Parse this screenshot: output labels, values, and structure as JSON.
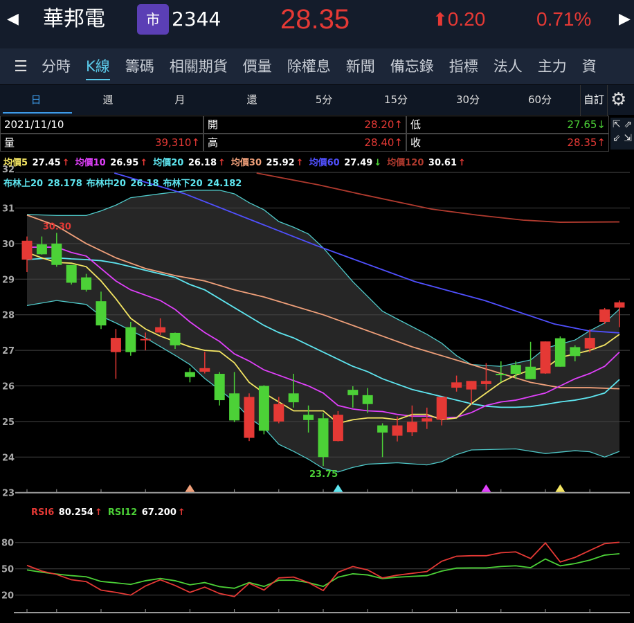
{
  "header": {
    "prev_icon": "◀",
    "next_icon": "▶",
    "name": "華邦電",
    "market_badge": "市",
    "code": "2344",
    "price": "28.35",
    "change": "0.20",
    "change_arrow": "🡅",
    "pct": "0.71%"
  },
  "tabs": [
    "分時",
    "K線",
    "籌碼",
    "相關期貨",
    "價量",
    "除權息",
    "新聞",
    "備忘錄",
    "指標",
    "法人",
    "主力",
    "資"
  ],
  "active_tab": 1,
  "subtabs": [
    "日",
    "週",
    "月",
    "還",
    "5分",
    "15分",
    "30分",
    "60分"
  ],
  "custom_label": "自訂",
  "info": {
    "date": "2021/11/10",
    "open_label": "開",
    "open": "28.20↑",
    "low_label": "低",
    "low": "27.65↓",
    "volume_label": "量",
    "volume": "39,310↑",
    "high_label": "高",
    "high": "28.40↑",
    "close_label": "收",
    "close": "28.35↑"
  },
  "ma_legend": [
    {
      "label": "均價5",
      "value": "27.45",
      "arrow": "↑",
      "color": "#f5e663"
    },
    {
      "label": "均價10",
      "value": "26.95",
      "arrow": "↑",
      "color": "#e040fb"
    },
    {
      "label": "均價20",
      "value": "26.18",
      "arrow": "↑",
      "color": "#5ee6f0"
    },
    {
      "label": "均價30",
      "value": "25.92",
      "arrow": "↑",
      "color": "#f0a07a"
    },
    {
      "label": "均價60",
      "value": "27.49",
      "arrow": "↓",
      "color": "#5050ff"
    },
    {
      "label": "均價120",
      "value": "30.61",
      "arrow": "↑",
      "color": "#b03a2e"
    }
  ],
  "boll_legend": [
    {
      "label": "布林上20",
      "value": "28.178"
    },
    {
      "label": "布林中20",
      "value": "26.18"
    },
    {
      "label": "布林下20",
      "value": "24.182"
    }
  ],
  "rsi_legend": [
    {
      "label": "RSI6",
      "value": "80.254",
      "arrow": "↑",
      "color": "#e53935"
    },
    {
      "label": "RSI12",
      "value": "67.200",
      "arrow": "↑",
      "color": "#4cd137"
    }
  ],
  "chart_data": {
    "type": "candlestick",
    "y_ticks": [
      "32",
      "31",
      "30",
      "29",
      "28",
      "27",
      "26",
      "25",
      "24",
      "23"
    ],
    "ylim": [
      23,
      32
    ],
    "candles_ohlc": [
      [
        29.55,
        30.2,
        29.2,
        30.08
      ],
      [
        29.98,
        30.2,
        29.69,
        29.7
      ],
      [
        30.0,
        30.3,
        29.35,
        29.4
      ],
      [
        29.4,
        29.4,
        28.85,
        28.9
      ],
      [
        29.05,
        29.15,
        28.65,
        28.7
      ],
      [
        28.38,
        28.65,
        27.6,
        27.7
      ],
      [
        26.95,
        27.6,
        26.2,
        27.35
      ],
      [
        27.65,
        27.8,
        26.85,
        26.95
      ],
      [
        27.3,
        27.5,
        27.0,
        27.32
      ],
      [
        27.5,
        27.9,
        27.43,
        27.65
      ],
      [
        27.49,
        27.5,
        27.04,
        27.14
      ],
      [
        26.39,
        26.5,
        26.1,
        26.25
      ],
      [
        26.4,
        26.96,
        26.35,
        26.5
      ],
      [
        26.34,
        26.39,
        25.45,
        25.6
      ],
      [
        25.79,
        26.39,
        24.98,
        25.03
      ],
      [
        24.54,
        25.79,
        24.45,
        25.69
      ],
      [
        26.0,
        26.02,
        24.64,
        24.74
      ],
      [
        25.0,
        25.69,
        24.95,
        25.49
      ],
      [
        25.79,
        26.34,
        25.39,
        25.54
      ],
      [
        25.19,
        25.45,
        24.69,
        25.04
      ],
      [
        25.09,
        25.24,
        23.75,
        24.0
      ],
      [
        24.45,
        25.29,
        24.44,
        25.19
      ],
      [
        25.89,
        25.99,
        25.39,
        25.74
      ],
      [
        25.74,
        25.94,
        25.24,
        25.49
      ],
      [
        24.89,
        24.95,
        24.0,
        24.69
      ],
      [
        24.6,
        25.14,
        24.44,
        24.89
      ],
      [
        24.7,
        25.45,
        24.59,
        24.99
      ],
      [
        25.0,
        25.39,
        24.79,
        25.09
      ],
      [
        25.05,
        25.69,
        24.89,
        25.69
      ],
      [
        25.95,
        26.29,
        25.84,
        26.1
      ],
      [
        25.9,
        26.14,
        25.49,
        26.14
      ],
      [
        26.05,
        26.64,
        25.89,
        26.14
      ],
      [
        26.34,
        26.69,
        26.1,
        26.3
      ],
      [
        26.59,
        26.69,
        26.19,
        26.34
      ],
      [
        26.54,
        27.24,
        26.19,
        26.19
      ],
      [
        26.35,
        27.25,
        26.34,
        27.25
      ],
      [
        27.34,
        27.39,
        26.54,
        26.54
      ],
      [
        27.09,
        27.14,
        26.69,
        26.84
      ],
      [
        27.05,
        27.59,
        26.94,
        27.35
      ],
      [
        27.8,
        28.19,
        27.74,
        28.15
      ],
      [
        28.2,
        28.4,
        27.65,
        28.35
      ]
    ],
    "up_color": "#e53935",
    "down_color": "#4cd137",
    "lines": [
      {
        "name": "boll_upper",
        "color": "#4fc9c9",
        "points": [
          [
            0,
            30.82
          ],
          [
            2,
            30.79
          ],
          [
            4,
            30.79
          ],
          [
            5,
            30.92
          ],
          [
            6,
            31.08
          ],
          [
            7,
            31.29
          ],
          [
            9,
            31.4
          ],
          [
            11,
            31.5
          ],
          [
            13,
            31.5
          ],
          [
            14,
            31.4
          ],
          [
            15,
            31.15
          ],
          [
            16,
            30.95
          ],
          [
            17,
            30.62
          ],
          [
            18,
            30.46
          ],
          [
            19,
            30.27
          ],
          [
            20,
            29.88
          ],
          [
            22,
            28.93
          ],
          [
            24,
            28.1
          ],
          [
            25,
            27.88
          ],
          [
            27,
            27.45
          ],
          [
            28,
            27.2
          ],
          [
            29,
            26.85
          ],
          [
            30,
            26.6
          ],
          [
            32,
            26.55
          ],
          [
            34,
            26.73
          ],
          [
            35,
            27.06
          ],
          [
            37,
            27.29
          ],
          [
            38,
            27.55
          ],
          [
            39,
            27.77
          ],
          [
            40,
            28.16
          ]
        ]
      },
      {
        "name": "boll_lower",
        "color": "#4fc9c9",
        "points": [
          [
            0,
            28.26
          ],
          [
            2,
            28.4
          ],
          [
            4,
            28.29
          ],
          [
            5,
            27.96
          ],
          [
            6,
            27.77
          ],
          [
            8,
            27.35
          ],
          [
            10,
            26.86
          ],
          [
            11,
            26.6
          ],
          [
            12,
            26.21
          ],
          [
            13,
            25.89
          ],
          [
            14,
            25.56
          ],
          [
            15,
            25.1
          ],
          [
            16,
            24.82
          ],
          [
            17,
            24.36
          ],
          [
            18,
            24.16
          ],
          [
            19,
            23.94
          ],
          [
            20,
            23.68
          ],
          [
            21,
            23.58
          ],
          [
            22,
            23.71
          ],
          [
            23,
            23.8
          ],
          [
            25,
            23.84
          ],
          [
            27,
            23.78
          ],
          [
            28,
            23.87
          ],
          [
            29,
            24.07
          ],
          [
            30,
            24.2
          ],
          [
            33,
            24.23
          ],
          [
            35,
            24.1
          ],
          [
            37,
            24.18
          ],
          [
            38,
            24.15
          ],
          [
            39,
            24.0
          ],
          [
            40,
            24.16
          ]
        ]
      },
      {
        "name": "ma120",
        "color": "#b03a2e",
        "points": [
          [
            15.5,
            32.0
          ],
          [
            19.7,
            31.65
          ],
          [
            22.4,
            31.4
          ],
          [
            27.3,
            30.97
          ],
          [
            30.4,
            30.8
          ],
          [
            33.5,
            30.66
          ],
          [
            36,
            30.6
          ],
          [
            40,
            30.61
          ]
        ]
      },
      {
        "name": "ma60",
        "color": "#5050ff",
        "points": [
          [
            5.9,
            32.0
          ],
          [
            10.65,
            31.4
          ],
          [
            19.5,
            29.95
          ],
          [
            26.2,
            28.93
          ],
          [
            30.9,
            28.4
          ],
          [
            35.6,
            27.74
          ],
          [
            37.9,
            27.55
          ],
          [
            40,
            27.49
          ]
        ]
      },
      {
        "name": "ma30",
        "color": "#f0a07a",
        "points": [
          [
            0,
            30.8
          ],
          [
            2,
            30.5
          ],
          [
            4,
            30.0
          ],
          [
            6,
            29.6
          ],
          [
            8,
            29.3
          ],
          [
            10,
            29.1
          ],
          [
            12,
            28.95
          ],
          [
            14,
            28.7
          ],
          [
            16,
            28.5
          ],
          [
            18,
            28.25
          ],
          [
            20,
            28.0
          ],
          [
            22,
            27.7
          ],
          [
            24,
            27.4
          ],
          [
            26,
            27.1
          ],
          [
            28,
            26.85
          ],
          [
            30,
            26.6
          ],
          [
            32,
            26.35
          ],
          [
            34,
            26.1
          ],
          [
            36,
            25.95
          ],
          [
            38,
            25.95
          ],
          [
            40,
            25.92
          ]
        ]
      },
      {
        "name": "ma20",
        "color": "#5ee6f0",
        "values": [
          29.55,
          29.58,
          29.6,
          29.57,
          29.55,
          29.52,
          29.45,
          29.35,
          29.25,
          29.15,
          29.05,
          28.85,
          28.7,
          28.45,
          28.2,
          27.95,
          27.7,
          27.5,
          27.35,
          27.15,
          26.95,
          26.75,
          26.55,
          26.4,
          26.2,
          26.05,
          25.9,
          25.8,
          25.7,
          25.6,
          25.5,
          25.43,
          25.4,
          25.4,
          25.42,
          25.48,
          25.55,
          25.6,
          25.68,
          25.8,
          26.18
        ]
      },
      {
        "name": "ma10",
        "color": "#e040fb",
        "values": [
          29.9,
          29.9,
          29.9,
          29.75,
          29.65,
          29.3,
          28.95,
          28.7,
          28.55,
          28.4,
          28.15,
          27.8,
          27.5,
          27.25,
          26.9,
          26.7,
          26.45,
          26.3,
          26.15,
          26.0,
          25.8,
          25.45,
          25.35,
          25.3,
          25.28,
          25.2,
          25.15,
          25.15,
          25.1,
          25.12,
          25.25,
          25.45,
          25.55,
          25.6,
          25.7,
          25.8,
          26.0,
          26.2,
          26.35,
          26.55,
          26.95
        ]
      },
      {
        "name": "ma5",
        "color": "#f5e663",
        "values": [
          29.75,
          29.6,
          29.47,
          29.45,
          29.35,
          28.95,
          28.45,
          27.9,
          27.6,
          27.4,
          27.25,
          27.1,
          27.0,
          26.97,
          26.65,
          26.1,
          25.8,
          25.55,
          25.3,
          25.3,
          25.3,
          24.95,
          25.05,
          25.1,
          25.1,
          25.05,
          25.2,
          25.2,
          25.05,
          25.1,
          25.5,
          25.8,
          26.1,
          26.3,
          26.45,
          26.5,
          26.8,
          26.9,
          27.0,
          27.15,
          27.45
        ]
      }
    ],
    "annotations": [
      {
        "text": "30.30",
        "index": 2,
        "value": 30.3,
        "color": "#e53935"
      },
      {
        "text": "23.75",
        "index": 20,
        "value": 23.75,
        "color": "#4cd137"
      }
    ],
    "signal_markers": [
      {
        "index": 11,
        "color": "#f0a07a"
      },
      {
        "index": 21,
        "color": "#5ee6f0"
      },
      {
        "index": 31,
        "color": "#e040fb"
      },
      {
        "index": 36,
        "color": "#f5e663"
      }
    ],
    "x_tick_indices": [
      0,
      2,
      5,
      8,
      11,
      14,
      17,
      20,
      23,
      26,
      29,
      32,
      35,
      38
    ],
    "rsi": {
      "y_ticks": [
        "80",
        "50",
        "20"
      ],
      "rsi6": [
        53.9,
        47.4,
        43.5,
        37.5,
        35.4,
        25.7,
        23.1,
        20,
        30.4,
        37.5,
        31,
        23.1,
        29.1,
        21.8,
        18.4,
        33.5,
        25.7,
        39.6,
        40.6,
        34.3,
        25.2,
        46.1,
        52.6,
        48.7,
        39.6,
        42.7,
        44.8,
        46.9,
        58.6,
        64.3,
        64.9,
        64.9,
        68.3,
        69.3,
        61.7,
        79.5,
        57.8,
        63,
        70.9,
        78.7,
        80.25
      ],
      "rsi12": [
        48.7,
        46.1,
        44,
        42.2,
        40.9,
        35.6,
        34,
        32.2,
        36.4,
        39,
        36.4,
        31.7,
        34.3,
        29.6,
        27.8,
        34.3,
        29.9,
        37,
        37,
        34.3,
        29.9,
        40.4,
        44.3,
        43,
        38.8,
        40.4,
        41.4,
        42.2,
        47.4,
        50.8,
        51,
        51,
        52.6,
        53.4,
        51.3,
        61.2,
        53.4,
        56,
        59.9,
        65.6,
        67.2
      ]
    }
  }
}
